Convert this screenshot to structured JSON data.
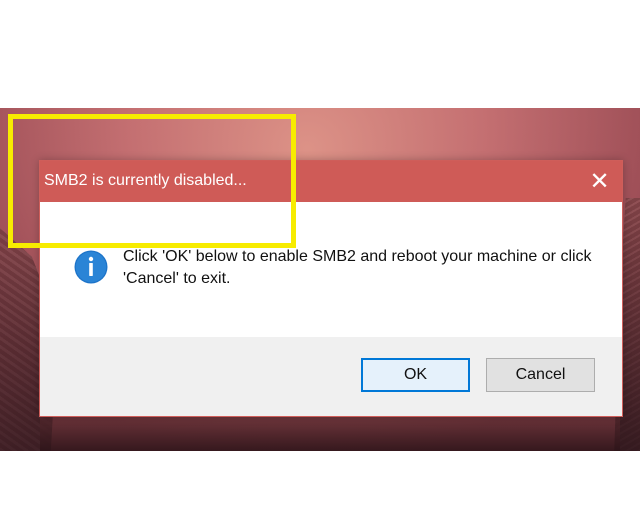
{
  "dialog": {
    "title": "SMB2 is currently disabled...",
    "close_glyph": "✕",
    "icon": "info-icon",
    "message": "Click 'OK' below to enable SMB2 and reboot your machine or click 'Cancel' to exit.",
    "buttons": {
      "ok_label": "OK",
      "cancel_label": "Cancel"
    }
  },
  "colors": {
    "titlebar": "#cf5b57",
    "highlight": "#f7ec00",
    "accent": "#0078d7"
  }
}
